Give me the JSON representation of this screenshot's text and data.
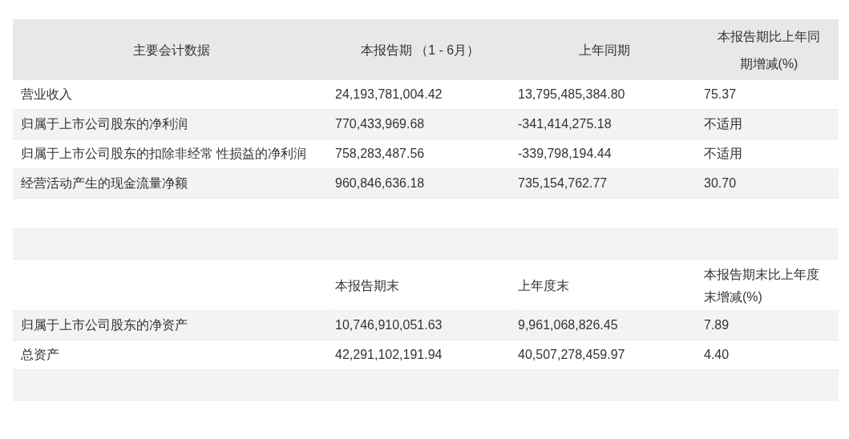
{
  "table": {
    "columns": [
      "主要会计数据",
      "本报告期 （1 - 6月）",
      "上年同期",
      "本报告期比上年同期增减(%)"
    ],
    "rows": [
      {
        "kind": "data",
        "cells": [
          "营业收入",
          "24,193,781,004.42",
          "13,795,485,384.80",
          "75.37"
        ]
      },
      {
        "kind": "data",
        "cells": [
          "归属于上市公司股东的净利润",
          "770,433,969.68",
          "-341,414,275.18",
          "不适用"
        ]
      },
      {
        "kind": "data",
        "cells": [
          "归属于上市公司股东的扣除非经常 性损益的净利润",
          "758,283,487.56",
          "-339,798,194.44",
          "不适用"
        ]
      },
      {
        "kind": "data",
        "cells": [
          "经营活动产生的现金流量净额",
          "960,846,636.18",
          "735,154,762.77",
          "30.70"
        ]
      },
      {
        "kind": "blank"
      },
      {
        "kind": "blank"
      },
      {
        "kind": "subheader",
        "cells": [
          "本报告期末",
          "上年度末",
          "本报告期末比上年度末增减(%)"
        ]
      },
      {
        "kind": "data",
        "cells": [
          "归属于上市公司股东的净资产",
          "10,746,910,051.63",
          "9,961,068,826.45",
          "7.89"
        ]
      },
      {
        "kind": "data",
        "cells": [
          "总资产",
          "42,291,102,191.94",
          "40,507,278,459.97",
          "4.40"
        ]
      },
      {
        "kind": "blank"
      }
    ]
  }
}
